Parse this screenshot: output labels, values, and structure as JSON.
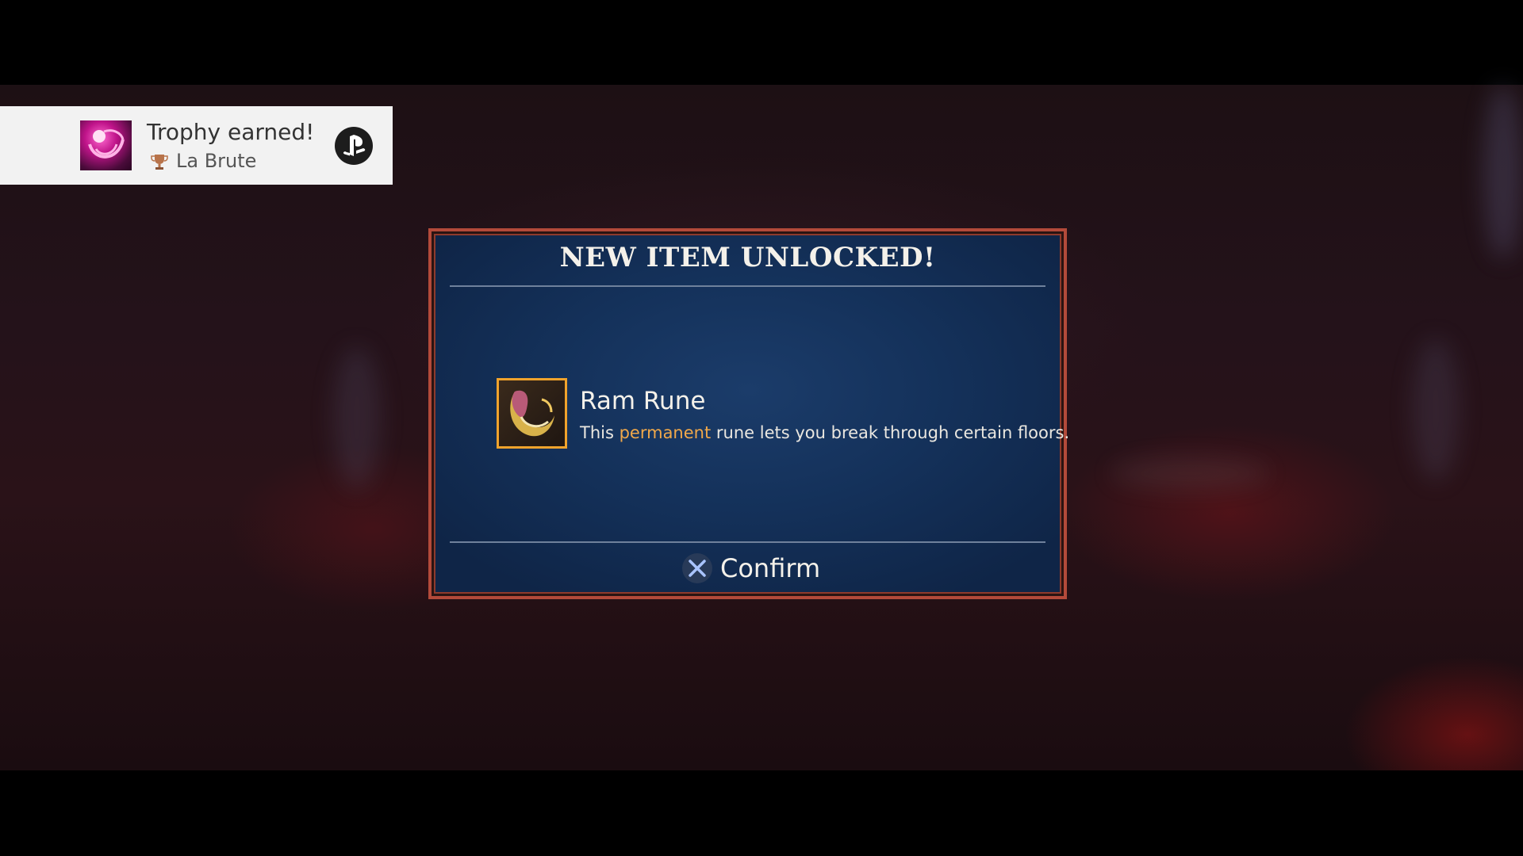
{
  "trophy": {
    "title": "Trophy earned!",
    "name": "La Brute",
    "art_icon": "trophy-art-icon",
    "cup_icon": "bronze-trophy-icon",
    "platform_icon": "playstation-logo-icon",
    "accent": "#c0148a"
  },
  "dialog": {
    "title": "NEW ITEM UNLOCKED!",
    "item": {
      "name": "Ram Rune",
      "icon": "ram-horn-icon",
      "desc_before": "This ",
      "desc_highlight": "permanent",
      "desc_after": " rune lets you break through certain floors."
    },
    "confirm": {
      "label": "Confirm",
      "button_icon": "cross-button-icon"
    },
    "colors": {
      "border": "#b34a3a",
      "background": "#14315a",
      "highlight": "#f0a84a",
      "item_frame": "#f0a32c"
    }
  }
}
